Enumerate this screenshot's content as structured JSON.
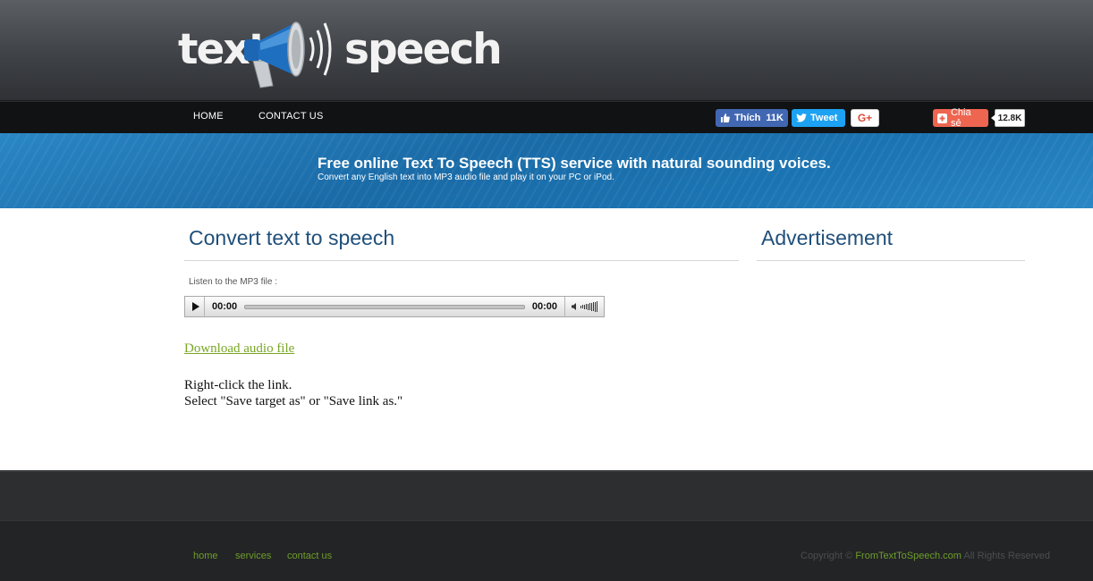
{
  "header": {
    "logo_left": "text",
    "logo_right": "speech",
    "logo_icon": "megaphone-icon"
  },
  "nav": {
    "home": "HOME",
    "contact": "CONTACT US"
  },
  "social": {
    "like_label": "Thích",
    "like_count": "11K",
    "tweet_label": "Tweet",
    "gplus_label": "G+",
    "share_label": "Chia sẻ",
    "share_count": "12.8K",
    "colors": {
      "facebook": "#4267b2",
      "twitter": "#1da1f2",
      "share": "#ee6550"
    }
  },
  "banner": {
    "title": "Free online Text To Speech (TTS) service with natural sounding voices.",
    "subtitle": "Convert any English text into MP3 audio file and play it on your PC or iPod."
  },
  "main": {
    "title": "Convert text to speech",
    "listen_label": "Listen to the MP3 file :",
    "player": {
      "current_time": "00:00",
      "duration": "00:00"
    },
    "download_label": "Download audio file",
    "instruction_line1": "Right-click the link.",
    "instruction_line2": "Select \"Save target as\" or \"Save link as.\""
  },
  "sidebar": {
    "title": "Advertisement"
  },
  "footer": {
    "links": [
      "home",
      "services",
      "contact us"
    ],
    "copyright_prefix": "Copyright ©",
    "copyright_brand": "FromTextToSpeech.com",
    "copyright_suffix": "All Rights Reserved",
    "link_color": "#6d9e2a"
  }
}
